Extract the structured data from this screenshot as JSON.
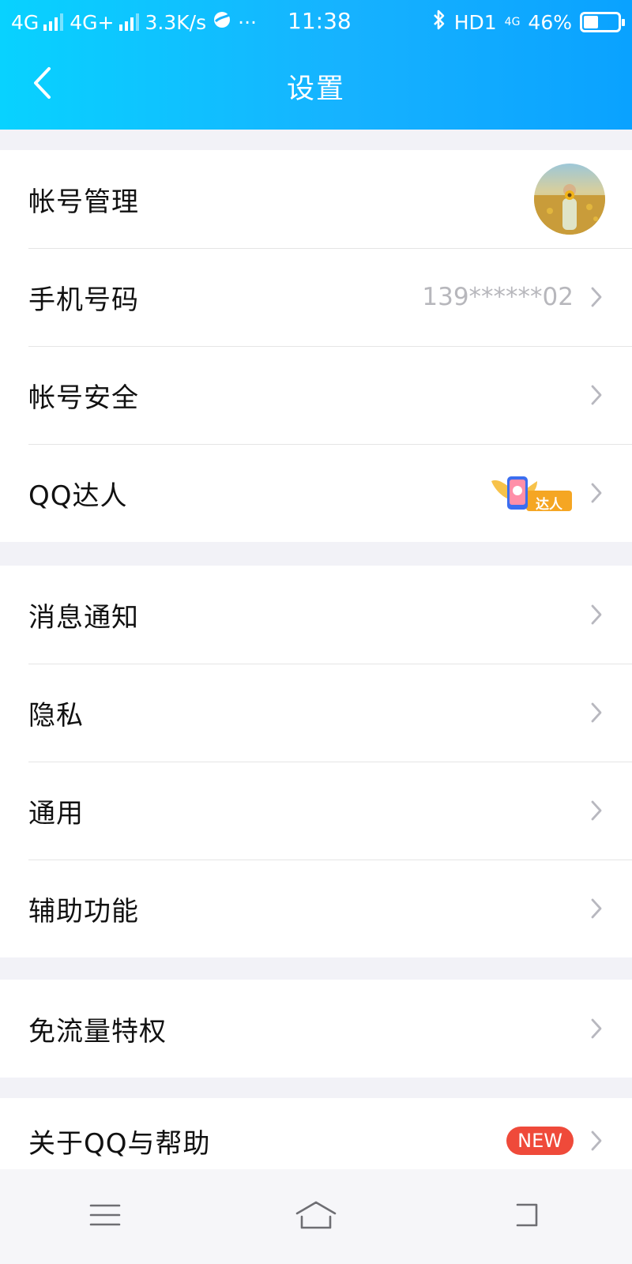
{
  "status_bar": {
    "sim1": "4G",
    "sim2": "4G+",
    "speed": "3.3K/s",
    "dots": "···",
    "time": "11:38",
    "bluetooth": "bluetooth-icon",
    "hd": "HD1",
    "network_small": "4G",
    "battery": "46%"
  },
  "header": {
    "title": "设置",
    "back_icon": "chevron-left-icon"
  },
  "groups": [
    {
      "items": [
        {
          "label": "帐号管理",
          "right": "avatar"
        },
        {
          "label": "手机号码",
          "value": "139******02"
        },
        {
          "label": "帐号安全"
        },
        {
          "label": "QQ达人",
          "badge": "达人"
        }
      ]
    },
    {
      "items": [
        {
          "label": "消息通知"
        },
        {
          "label": "隐私"
        },
        {
          "label": "通用"
        },
        {
          "label": "辅助功能"
        }
      ]
    },
    {
      "items": [
        {
          "label": "免流量特权"
        }
      ]
    },
    {
      "items": [
        {
          "label": "关于QQ与帮助",
          "badge": "NEW"
        }
      ]
    }
  ],
  "nav": {
    "menu_icon": "menu-icon",
    "home_icon": "home-icon",
    "back_icon": "back-icon"
  },
  "colors": {
    "header_gradient_start": "#08d2ff",
    "header_gradient_end": "#0aa2ff",
    "badge_red": "#ef4a3a",
    "chevron": "#b8b8bf"
  }
}
